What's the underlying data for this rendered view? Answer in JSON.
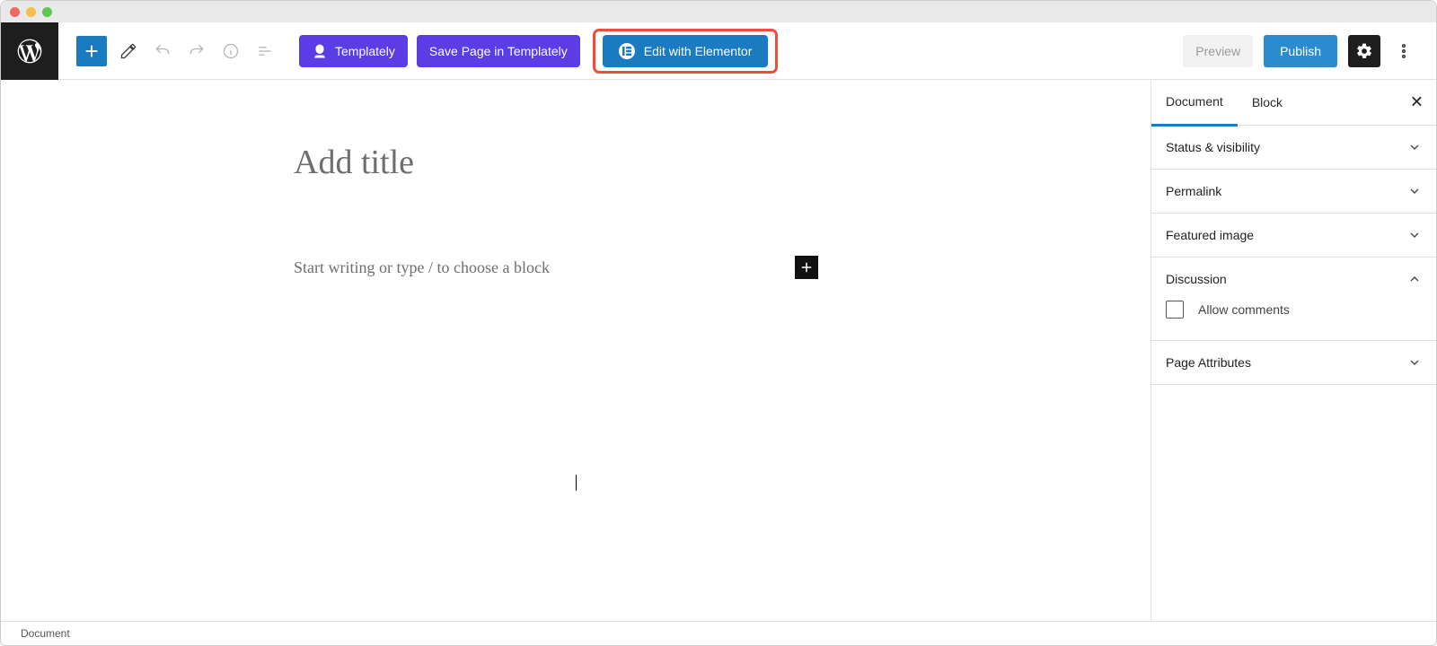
{
  "toolbar": {
    "templately_label": "Templately",
    "save_templately_label": "Save Page in Templately",
    "edit_elementor_label": "Edit with Elementor",
    "preview_label": "Preview",
    "publish_label": "Publish"
  },
  "editor": {
    "title_placeholder": "Add title",
    "block_placeholder": "Start writing or type / to choose a block"
  },
  "sidebar": {
    "tabs": {
      "document": "Document",
      "block": "Block"
    },
    "panels": {
      "status": "Status & visibility",
      "permalink": "Permalink",
      "featured": "Featured image",
      "discussion": "Discussion",
      "allow_comments": "Allow comments",
      "page_attrs": "Page Attributes"
    }
  },
  "footer": {
    "breadcrumb": "Document"
  }
}
